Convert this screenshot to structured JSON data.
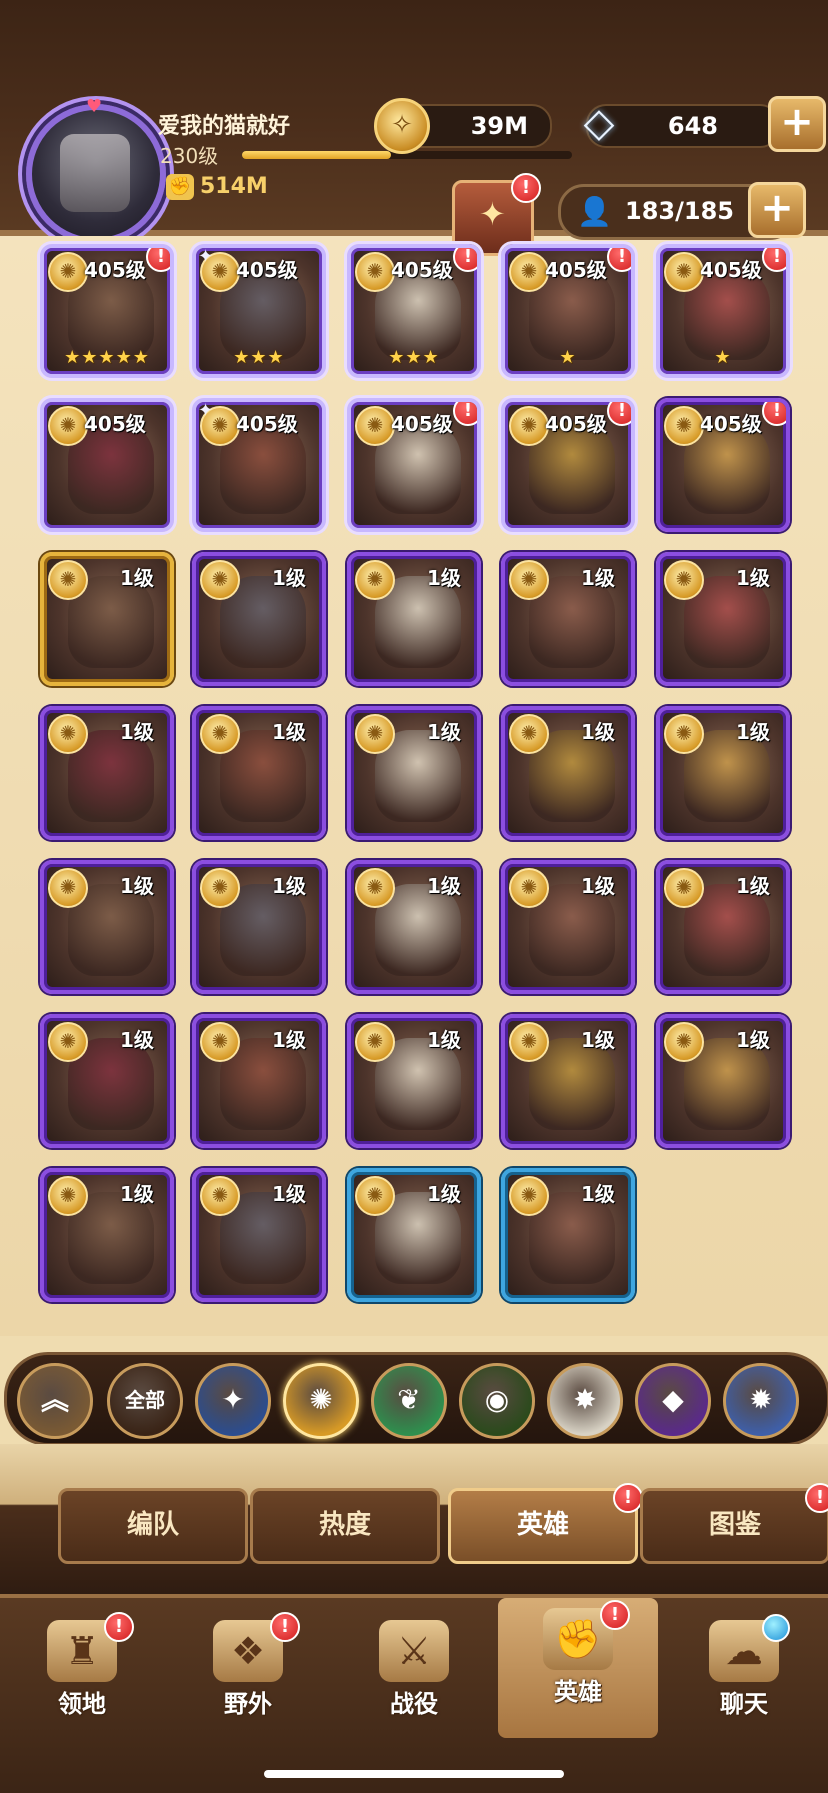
{
  "player": {
    "name": "爱我的猫就好",
    "level": "230级",
    "xp_fraction": 0.45,
    "power": "514M"
  },
  "resources": {
    "gold": "39M",
    "gems": "648"
  },
  "heroes": {
    "count": "183/185",
    "cards": [
      {
        "level": "405级",
        "stars": "★★★★★",
        "tier": "light",
        "badge": "!"
      },
      {
        "level": "405级",
        "stars": "★★★",
        "tier": "light",
        "badge": "",
        "wings": "✦"
      },
      {
        "level": "405级",
        "stars": "★★★",
        "tier": "light",
        "badge": "!"
      },
      {
        "level": "405级",
        "stars": "★",
        "tier": "light",
        "badge": "!"
      },
      {
        "level": "405级",
        "stars": "★",
        "tier": "light",
        "badge": "!"
      },
      {
        "level": "405级",
        "stars": "",
        "tier": "light",
        "badge": ""
      },
      {
        "level": "405级",
        "stars": "",
        "tier": "light",
        "badge": "",
        "wings": "✦"
      },
      {
        "level": "405级",
        "stars": "",
        "tier": "light",
        "badge": "!"
      },
      {
        "level": "405级",
        "stars": "",
        "tier": "light",
        "badge": "!"
      },
      {
        "level": "405级",
        "stars": "",
        "tier": "purple",
        "badge": "!"
      },
      {
        "level": "1级",
        "stars": "",
        "tier": "gold",
        "badge": ""
      },
      {
        "level": "1级",
        "stars": "",
        "tier": "purple",
        "badge": ""
      },
      {
        "level": "1级",
        "stars": "",
        "tier": "purple",
        "badge": ""
      },
      {
        "level": "1级",
        "stars": "",
        "tier": "purple",
        "badge": ""
      },
      {
        "level": "1级",
        "stars": "",
        "tier": "purple",
        "badge": ""
      },
      {
        "level": "1级",
        "stars": "",
        "tier": "purple",
        "badge": ""
      },
      {
        "level": "1级",
        "stars": "",
        "tier": "purple",
        "badge": ""
      },
      {
        "level": "1级",
        "stars": "",
        "tier": "purple",
        "badge": ""
      },
      {
        "level": "1级",
        "stars": "",
        "tier": "purple",
        "badge": ""
      },
      {
        "level": "1级",
        "stars": "",
        "tier": "purple",
        "badge": ""
      },
      {
        "level": "1级",
        "stars": "",
        "tier": "purple",
        "badge": ""
      },
      {
        "level": "1级",
        "stars": "",
        "tier": "purple",
        "badge": ""
      },
      {
        "level": "1级",
        "stars": "",
        "tier": "purple",
        "badge": ""
      },
      {
        "level": "1级",
        "stars": "",
        "tier": "purple",
        "badge": ""
      },
      {
        "level": "1级",
        "stars": "",
        "tier": "purple",
        "badge": ""
      },
      {
        "level": "1级",
        "stars": "",
        "tier": "purple",
        "badge": ""
      },
      {
        "level": "1级",
        "stars": "",
        "tier": "purple",
        "badge": ""
      },
      {
        "level": "1级",
        "stars": "",
        "tier": "purple",
        "badge": ""
      },
      {
        "level": "1级",
        "stars": "",
        "tier": "purple",
        "badge": ""
      },
      {
        "level": "1级",
        "stars": "",
        "tier": "purple",
        "badge": ""
      },
      {
        "level": "1级",
        "stars": "",
        "tier": "purple",
        "badge": ""
      },
      {
        "level": "1级",
        "stars": "",
        "tier": "purple",
        "badge": ""
      },
      {
        "level": "1级",
        "stars": "",
        "tier": "blue",
        "badge": ""
      },
      {
        "level": "1级",
        "stars": "",
        "tier": "blue",
        "badge": ""
      }
    ]
  },
  "faction_filter": [
    {
      "label": "",
      "icon": "double-chevron-up-icon",
      "glyph": "︽",
      "color": "#7a5a34"
    },
    {
      "label": "全部",
      "icon": "all-icon",
      "glyph": "",
      "color": "#3a2416"
    },
    {
      "label": "",
      "icon": "compass-star-icon",
      "glyph": "✦",
      "color": "#2c4d8f"
    },
    {
      "label": "",
      "icon": "lightbearer-icon",
      "glyph": "✺",
      "color": "#d79a26"
    },
    {
      "label": "",
      "icon": "leaf-icon",
      "glyph": "❦",
      "color": "#2f8f4e"
    },
    {
      "label": "",
      "icon": "eye-icon",
      "glyph": "◉",
      "color": "#2b4a1c"
    },
    {
      "label": "",
      "icon": "radiant-star-icon",
      "glyph": "✸",
      "color": "#d8d2c4"
    },
    {
      "label": "",
      "icon": "hypogean-icon",
      "glyph": "◆",
      "color": "#5a2a8a"
    },
    {
      "label": "",
      "icon": "celestial-shield-icon",
      "glyph": "✹",
      "color": "#3f5fa8"
    }
  ],
  "sub_tabs": [
    {
      "label": "编队",
      "badge": ""
    },
    {
      "label": "热度",
      "badge": ""
    },
    {
      "label": "英雄",
      "badge": "!"
    },
    {
      "label": "图鉴",
      "badge": "!"
    }
  ],
  "bottom_nav": [
    {
      "label": "领地",
      "icon": "castle-icon",
      "glyph": "♜",
      "badge": "!"
    },
    {
      "label": "野外",
      "icon": "scroll-map-icon",
      "glyph": "❖",
      "badge": "!"
    },
    {
      "label": "战役",
      "icon": "sword-emblem-icon",
      "glyph": "⚔",
      "badge": ""
    },
    {
      "label": "英雄",
      "icon": "hero-fist-icon",
      "glyph": "✊",
      "badge": "!"
    },
    {
      "label": "聊天",
      "icon": "chat-bubble-icon",
      "glyph": "☁",
      "badge": ""
    }
  ],
  "colors": {
    "accent_gold": "#f7d06a",
    "badge_red": "#d01b1b",
    "header_brown": "#4b2e1b"
  }
}
